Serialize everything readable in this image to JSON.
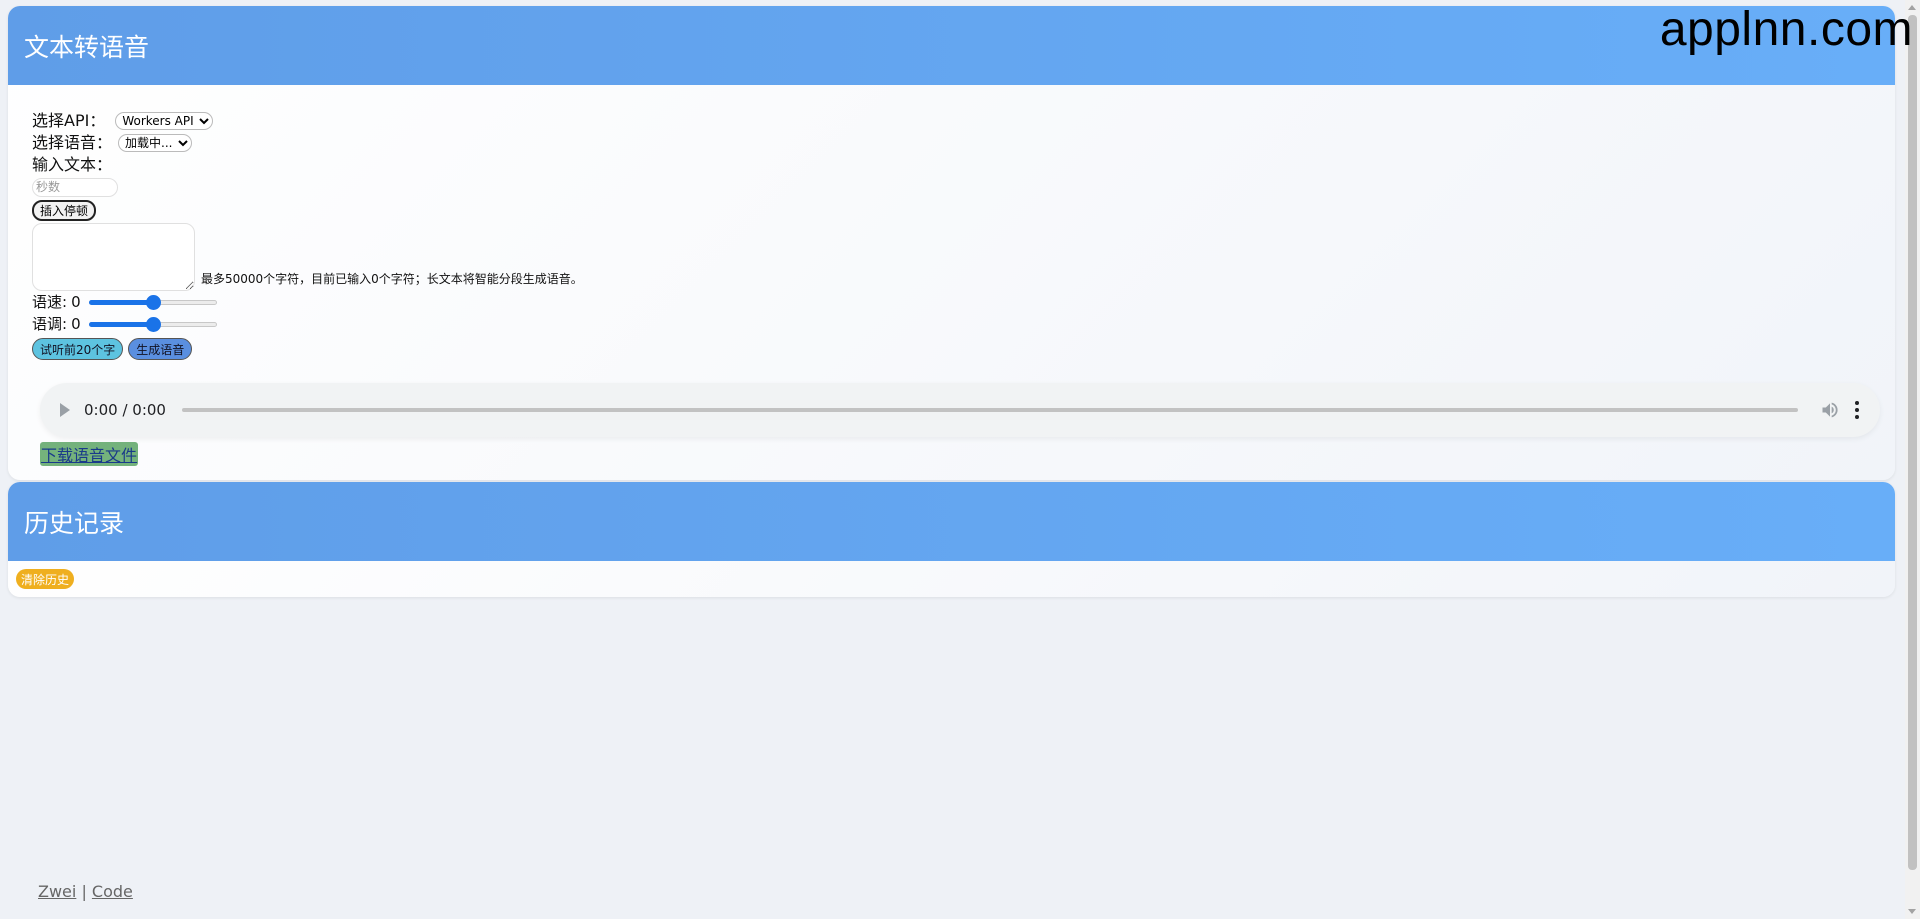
{
  "brand": "applnn.com",
  "tts": {
    "title": "文本转语音",
    "api_label": "选择API：",
    "api_selected": "Workers API",
    "voice_label": "选择语音：",
    "voice_selected": "加载中...",
    "text_label": "输入文本：",
    "pause_placeholder": "秒数",
    "insert_pause_label": "插入停顿",
    "hint": "最多50000个字符，目前已输入0个字符；长文本将智能分段生成语音。",
    "rate_label": "语速:",
    "rate_value": "0",
    "rate_fraction": 0.5,
    "pitch_label": "语调:",
    "pitch_value": "0",
    "pitch_fraction": 0.5,
    "preview_label": "试听前20个字",
    "generate_label": "生成语音",
    "audio_time": "0:00 / 0:00",
    "download_label": "下载语音文件"
  },
  "history": {
    "title": "历史记录",
    "clear_label": "清除历史"
  },
  "footer": {
    "link1": "Zwei",
    "separator": "|",
    "link2": "Code"
  },
  "colors": {
    "header_blue": "#5f9de8",
    "accent_blue": "#1a73e8",
    "clear_orange": "#efaf1f"
  }
}
